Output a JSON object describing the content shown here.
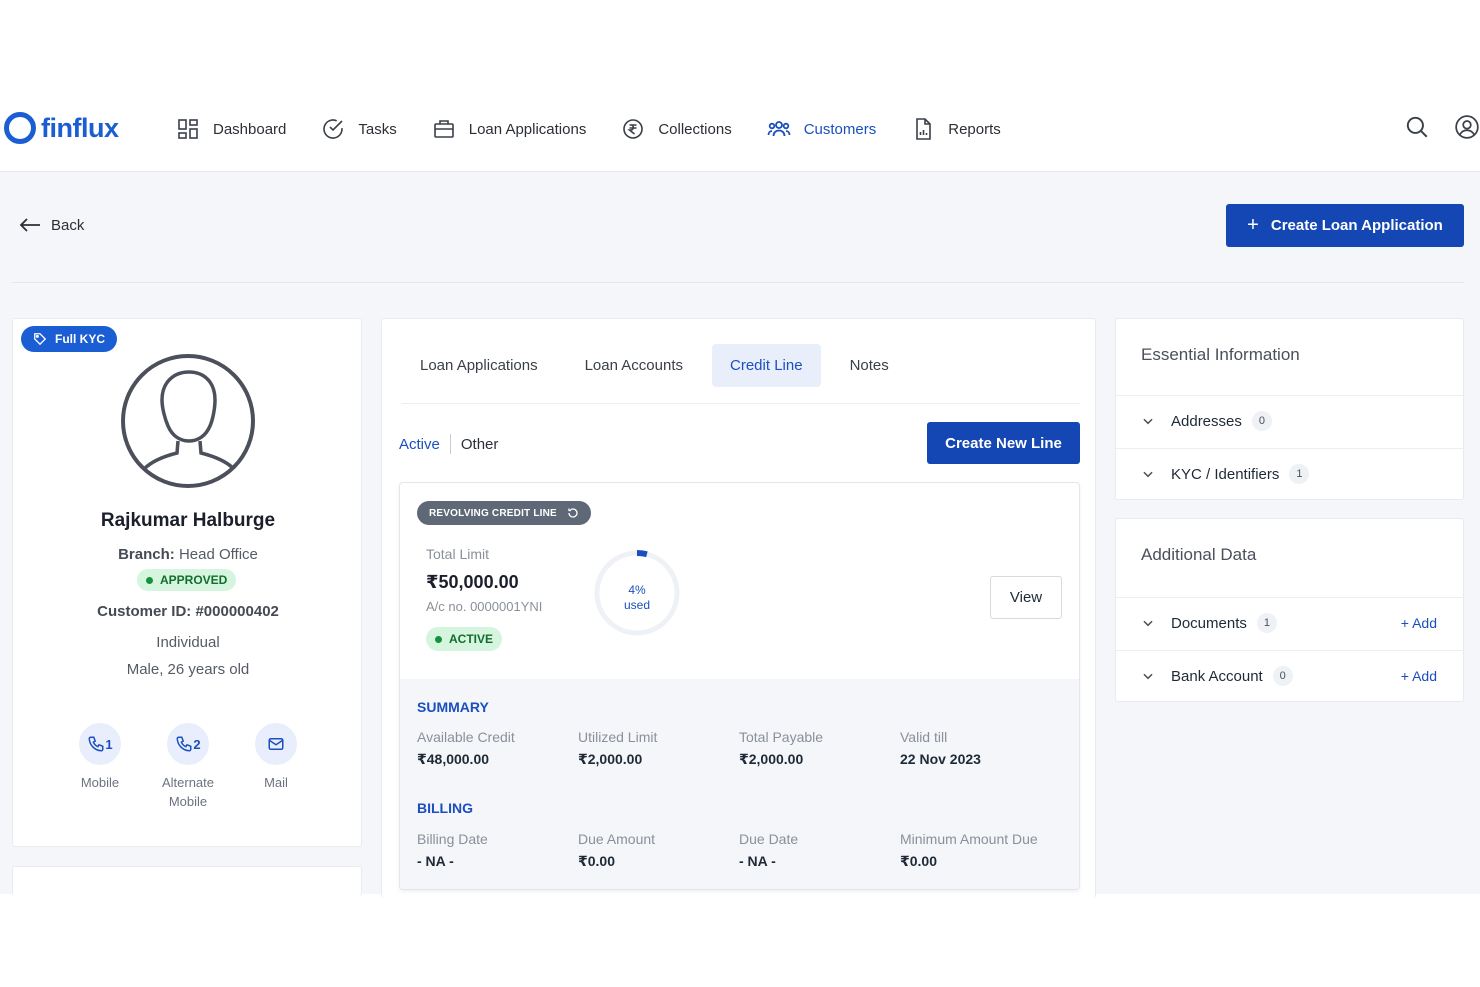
{
  "brand": {
    "name": "finflux"
  },
  "nav": {
    "items": [
      {
        "label": "Dashboard",
        "icon": "dashboard-icon"
      },
      {
        "label": "Tasks",
        "icon": "check-circle-icon"
      },
      {
        "label": "Loan Applications",
        "icon": "briefcase-icon"
      },
      {
        "label": "Collections",
        "icon": "rupee-circle-icon"
      },
      {
        "label": "Customers",
        "icon": "users-icon",
        "active": true
      },
      {
        "label": "Reports",
        "icon": "report-icon"
      }
    ]
  },
  "header": {
    "back_label": "Back",
    "create_loan_label": "Create Loan Application"
  },
  "profile": {
    "kyc_badge": "Full KYC",
    "name": "Rajkumar Halburge",
    "branch_label": "Branch:",
    "branch_value": "Head Office",
    "status": "APPROVED",
    "customer_id": "Customer ID: #000000402",
    "type": "Individual",
    "gender_age": "Male, 26 years old",
    "contacts": [
      {
        "label": "Mobile",
        "count": "1",
        "icon": "phone-icon"
      },
      {
        "label": "Alternate Mobile",
        "count": "2",
        "icon": "phone-icon"
      },
      {
        "label": "Mail",
        "count": "",
        "icon": "mail-icon"
      }
    ]
  },
  "tabs": [
    "Loan Applications",
    "Loan Accounts",
    "Credit Line",
    "Notes"
  ],
  "active_tab": "Credit Line",
  "filter": {
    "active": "Active",
    "other": "Other"
  },
  "create_line_label": "Create New Line",
  "credit_line": {
    "type_badge": "REVOLVING CREDIT LINE",
    "total_limit_label": "Total Limit",
    "total_limit": "₹50,000.00",
    "account_no": "A/c no. 0000001YNI",
    "status": "ACTIVE",
    "used_percent": 4,
    "used_text": "4%",
    "used_label": "used",
    "view_label": "View",
    "summary_title": "SUMMARY",
    "summary": [
      {
        "label": "Available Credit",
        "value": "₹48,000.00"
      },
      {
        "label": "Utilized Limit",
        "value": "₹2,000.00"
      },
      {
        "label": "Total Payable",
        "value": "₹2,000.00"
      },
      {
        "label": "Valid till",
        "value": "22 Nov 2023"
      }
    ],
    "billing_title": "BILLING",
    "billing": [
      {
        "label": "Billing Date",
        "value": "- NA -"
      },
      {
        "label": "Due Amount",
        "value": "₹0.00"
      },
      {
        "label": "Due Date",
        "value": "- NA -"
      },
      {
        "label": "Minimum Amount Due",
        "value": "₹0.00"
      }
    ]
  },
  "essential": {
    "title": "Essential Information",
    "rows": [
      {
        "label": "Addresses",
        "count": "0"
      },
      {
        "label": "KYC / Identifiers",
        "count": "1"
      }
    ]
  },
  "additional": {
    "title": "Additional Data",
    "rows": [
      {
        "label": "Documents",
        "count": "1",
        "action": "+ Add"
      },
      {
        "label": "Bank Account",
        "count": "0",
        "action": "+ Add"
      }
    ]
  },
  "colors": {
    "primary": "#1447b3",
    "accent": "#1b5dd3",
    "success_bg": "#d5f5df",
    "success_text": "#146c2e"
  }
}
